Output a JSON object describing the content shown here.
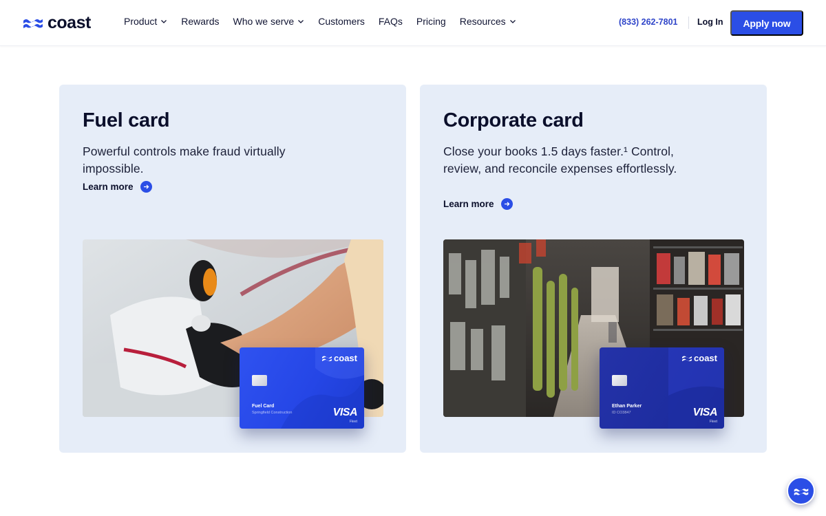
{
  "brand": {
    "name": "coast",
    "accent": "#2b4ee6",
    "navy": "#0b0f2b",
    "panel_bg": "#e6edf8"
  },
  "nav": {
    "items": [
      {
        "label": "Product",
        "dropdown": true
      },
      {
        "label": "Rewards",
        "dropdown": false
      },
      {
        "label": "Who we serve",
        "dropdown": true
      },
      {
        "label": "Customers",
        "dropdown": false
      },
      {
        "label": "FAQs",
        "dropdown": false
      },
      {
        "label": "Pricing",
        "dropdown": false
      },
      {
        "label": "Resources",
        "dropdown": true
      }
    ],
    "phone": "(833) 262-7801",
    "login": "Log In",
    "apply": "Apply now"
  },
  "cards": [
    {
      "title": "Fuel card",
      "description": "Powerful controls make fraud virtually impossible.",
      "cta": "Learn more",
      "photo_icon": "fuel-pump-photo",
      "credit_card": {
        "brand": "coast",
        "holder": "Fuel Card",
        "sub": "Springfield Construction",
        "network": "VISA",
        "network_sub": "Fleet"
      }
    },
    {
      "title": "Corporate card",
      "description": "Close your books 1.5 days faster.¹ Control, review, and reconcile expenses effortlessly.",
      "cta": "Learn more",
      "photo_icon": "hardware-store-photo",
      "credit_card": {
        "brand": "coast",
        "holder": "Ethan Parker",
        "sub": "ID CO3847",
        "network": "VISA",
        "network_sub": "Fleet"
      }
    }
  ],
  "floating_button_icon": "coast-waves-icon"
}
